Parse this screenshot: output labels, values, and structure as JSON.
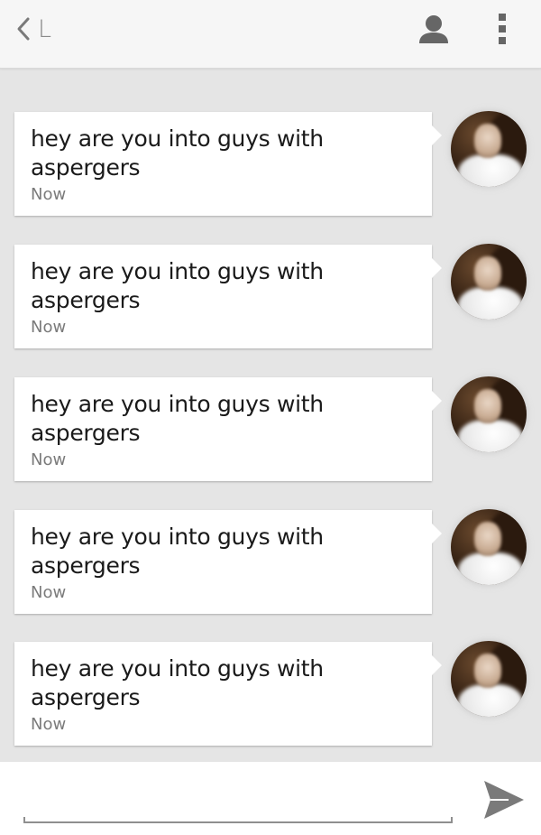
{
  "header": {
    "title": "L",
    "back_icon": "chevron-left-icon",
    "contact_icon": "person-icon",
    "overflow_icon": "more-vert-icon"
  },
  "messages": [
    {
      "text": "hey are you into guys with aspergers",
      "time": "Now"
    },
    {
      "text": "hey are you into guys with aspergers",
      "time": "Now"
    },
    {
      "text": "hey are you into guys with aspergers",
      "time": "Now"
    },
    {
      "text": "hey are you into guys with aspergers",
      "time": "Now"
    },
    {
      "text": "hey are you into guys with aspergers",
      "time": "Now"
    }
  ],
  "composer": {
    "value": "",
    "placeholder": "",
    "send_icon": "send-icon"
  },
  "colors": {
    "header_bg": "#f6f6f6",
    "conversation_bg": "#e5e5e5",
    "bubble_bg": "#ffffff",
    "icon_gray": "#7a7a7a"
  }
}
